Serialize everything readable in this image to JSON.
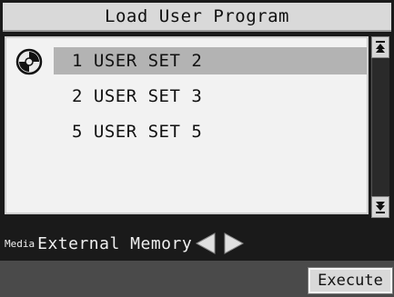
{
  "window": {
    "title": "Load User Program"
  },
  "program_list": {
    "items": [
      {
        "label": "1 USER SET 2",
        "selected": true
      },
      {
        "label": "2 USER SET 3",
        "selected": false
      },
      {
        "label": "5 USER SET 5",
        "selected": false
      }
    ],
    "disc_icon": "disc-icon"
  },
  "scrollbar": {
    "up_icon": "scroll-up-icon",
    "down_icon": "scroll-down-icon"
  },
  "media": {
    "label": "Media",
    "value": "External Memory",
    "prev_icon": "arrow-left-icon",
    "next_icon": "arrow-right-icon"
  },
  "actions": {
    "execute_label": "Execute"
  },
  "colors": {
    "selection": "#b3b3b3",
    "titlebar": "#d9d9d9",
    "background": "#1a1a1a",
    "bottombar": "#4a4a4a"
  }
}
